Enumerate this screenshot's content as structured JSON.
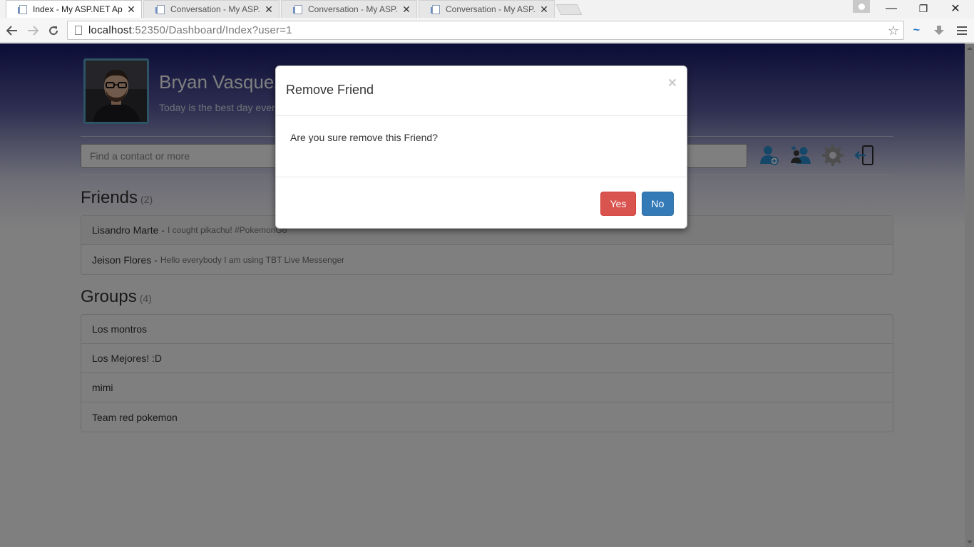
{
  "browser": {
    "tabs": [
      {
        "title": "Index - My ASP.NET Appli",
        "active": true
      },
      {
        "title": "Conversation - My ASP.NE",
        "active": false
      },
      {
        "title": "Conversation - My ASP.NE",
        "active": false
      },
      {
        "title": "Conversation - My ASP.NE",
        "active": false
      }
    ],
    "url_host": "localhost",
    "url_rest": ":52350/Dashboard/Index?user=1",
    "window_controls": {
      "minimize": "—",
      "restore": "❐",
      "close": "✕"
    }
  },
  "profile": {
    "name": "Bryan Vasquez",
    "status": "Today is the best day ever"
  },
  "search": {
    "placeholder": "Find a contact or more"
  },
  "actions": [
    "add-contact-icon",
    "add-group-icon",
    "settings-gear-icon",
    "logout-icon"
  ],
  "friends": {
    "title": "Friends",
    "count": "(2)",
    "items": [
      {
        "name": "Lisandro Marte -",
        "message": "I cought pikachu! #PokemonGo"
      },
      {
        "name": "Jeison Flores -",
        "message": "Hello everybody I am using TBT Live Messenger"
      }
    ]
  },
  "groups": {
    "title": "Groups",
    "count": "(4)",
    "items": [
      "Los montros",
      "Los Mejores! :D",
      "mimi",
      "Team red pokemon"
    ]
  },
  "modal": {
    "title": "Remove Friend",
    "close": "×",
    "body": "Are you sure remove this Friend?",
    "yes": "Yes",
    "no": "No"
  },
  "colors": {
    "header_top": "#181a6e",
    "yes_button": "#d9534f",
    "no_button": "#337ab7",
    "avatar_border": "#5aa6c8"
  }
}
